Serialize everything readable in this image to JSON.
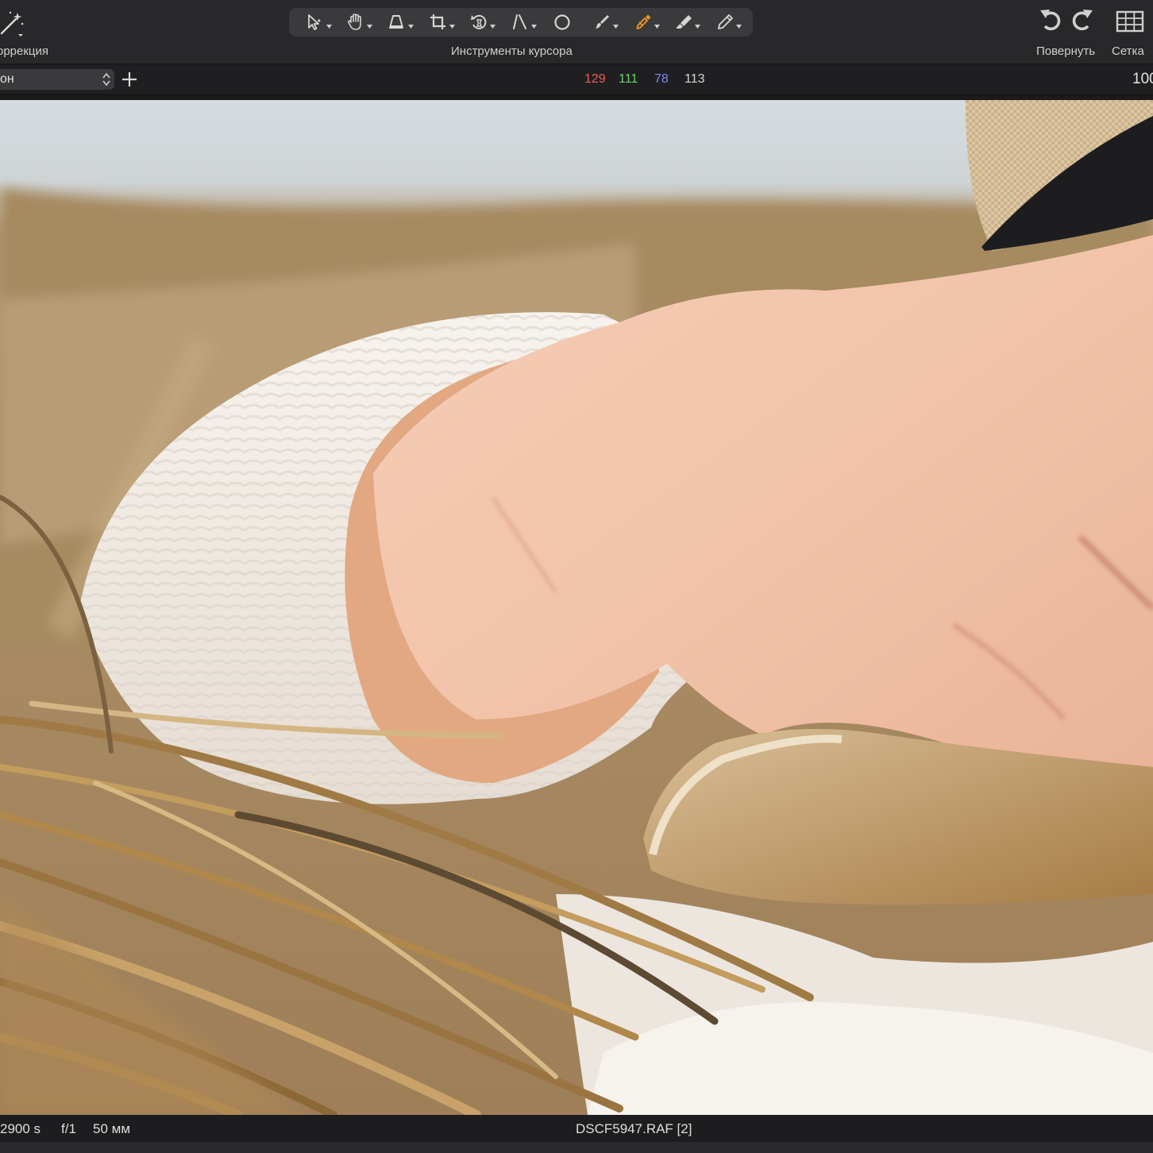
{
  "toolbar": {
    "correction_label": "оррекция",
    "cursor_tools_label": "Инструменты курсора",
    "rotate_label": "Повернуть",
    "grid_label": "Сетка",
    "cursor_tools": [
      {
        "icon": "select-arrow-icon"
      },
      {
        "icon": "pan-hand-icon"
      },
      {
        "icon": "keystone-icon"
      },
      {
        "icon": "crop-icon"
      },
      {
        "icon": "rotate-tool-icon"
      },
      {
        "icon": "straighten-icon"
      },
      {
        "icon": "circle-mask-icon"
      },
      {
        "icon": "brush-icon"
      },
      {
        "icon": "color-picker-icon",
        "active": true
      },
      {
        "icon": "eraser-brush-icon"
      },
      {
        "icon": "pen-annotate-icon"
      }
    ],
    "active_color": "#f0941e"
  },
  "subbar": {
    "style_select_value": "он",
    "readout": {
      "r": "129",
      "g": "111",
      "b": "78",
      "l": "113"
    },
    "zoom": "100"
  },
  "infobar": {
    "shutter": "2900 s",
    "aperture": "f/1",
    "focal": "50 мм",
    "filename": "DSCF5947.RAF [2]"
  }
}
